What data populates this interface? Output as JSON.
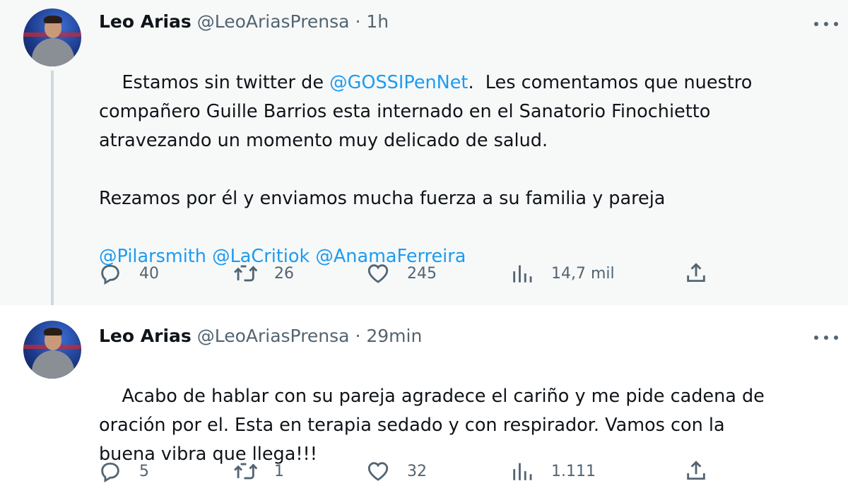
{
  "tweets": [
    {
      "name": "Leo Arias",
      "handle": "@LeoAriasPrensa",
      "dot": "·",
      "time": "1h",
      "text": [
        {
          "t": "Estamos sin twitter de "
        },
        {
          "t": "@GOSSIPenNet",
          "mention": true
        },
        {
          "t": ".  Les comentamos que nuestro\ncompañero Guille Barrios esta internado en el Sanatorio Finochietto\natravezando un momento muy delicado de salud.\n\nRezamos por él y enviamos mucha fuerza a su familia y pareja\n\n"
        },
        {
          "t": "@Pilarsmith",
          "mention": true
        },
        {
          "t": " "
        },
        {
          "t": "@LaCritiok",
          "mention": true
        },
        {
          "t": " "
        },
        {
          "t": "@AnamaFerreira",
          "mention": true
        }
      ],
      "replies": "40",
      "retweets": "26",
      "likes": "245",
      "views": "14,7 mil"
    },
    {
      "name": "Leo Arias",
      "handle": "@LeoAriasPrensa",
      "dot": "·",
      "time": "29min",
      "text": [
        {
          "t": "Acabo de hablar con su pareja agradece el cariño y me pide cadena de\noración por el. Esta en terapia sedado y con respirador. Vamos con la\nbuena vibra que llega!!!"
        }
      ],
      "replies": "5",
      "retweets": "1",
      "likes": "32",
      "views": "1.111"
    }
  ],
  "icons": {
    "reply": "reply-icon",
    "retweet": "retweet-icon",
    "like": "heart-icon",
    "views": "analytics-icon",
    "share": "share-icon",
    "more": "more-icon"
  },
  "colors": {
    "mention": "#1d9bf0",
    "secondary_text": "#536471",
    "first_tweet_bg": "#f7f9f9",
    "thread_line": "#cfd9de"
  }
}
